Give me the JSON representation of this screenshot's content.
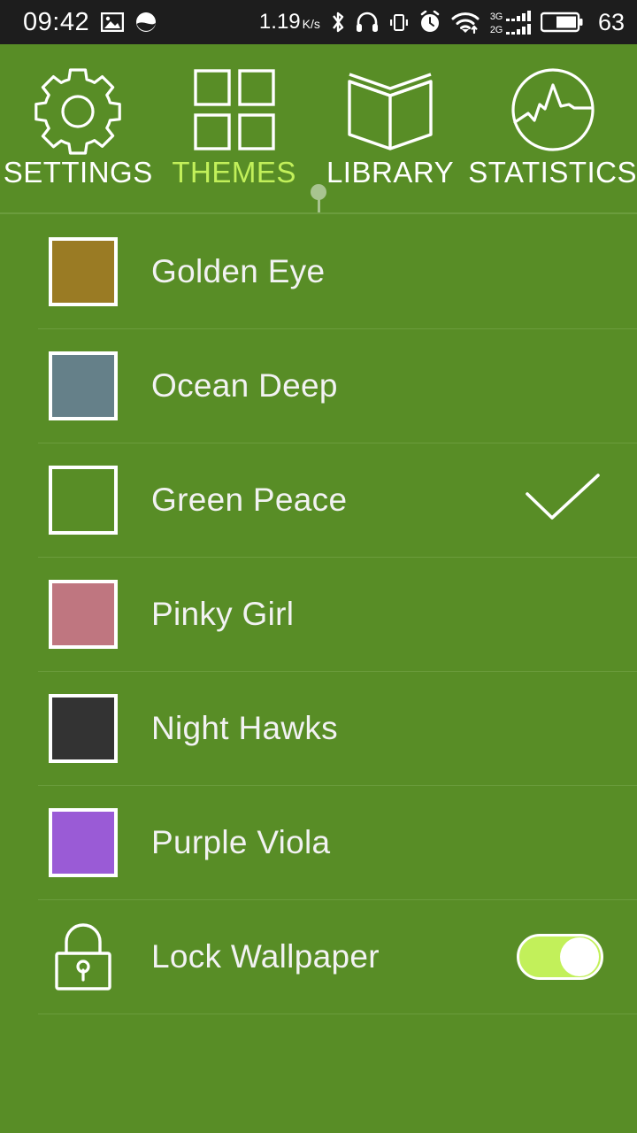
{
  "status_bar": {
    "time": "09:42",
    "network_speed": "1.19",
    "network_speed_unit": "K/s",
    "battery_percent": "63",
    "icons": [
      "image-icon",
      "brightness-icon",
      "bluetooth-icon",
      "headphones-icon",
      "vibrate-icon",
      "alarm-icon",
      "wifi-icon",
      "signal-icon",
      "battery-icon"
    ],
    "sim1_label": "3G",
    "sim2_label": "2G",
    "background": "#1d1d1d"
  },
  "tabs": [
    {
      "label": "SETTINGS",
      "icon": "gear-icon",
      "active": false
    },
    {
      "label": "THEMES",
      "icon": "grid-icon",
      "active": true
    },
    {
      "label": "LIBRARY",
      "icon": "book-icon",
      "active": false
    },
    {
      "label": "STATISTICS",
      "icon": "chart-circle-icon",
      "active": false
    }
  ],
  "theme": {
    "background": "#588d26",
    "accent": "#c2f05a",
    "divider": "#6b9c3d",
    "text": "#f2f2f2"
  },
  "themes_list": [
    {
      "name": "Golden Eye",
      "swatch": "#9a7b24",
      "selected": false
    },
    {
      "name": "Ocean Deep",
      "swatch": "#658089",
      "selected": false
    },
    {
      "name": "Green Peace",
      "swatch": "#588d26",
      "selected": true
    },
    {
      "name": "Pinky Girl",
      "swatch": "#bf7680",
      "selected": false
    },
    {
      "name": "Night Hawks",
      "swatch": "#333333",
      "selected": false
    },
    {
      "name": "Purple Viola",
      "swatch": "#9a5bd6",
      "selected": false
    }
  ],
  "lock_wallpaper": {
    "label": "Lock Wallpaper",
    "icon": "lock-icon",
    "enabled": true,
    "toggle_state": "on"
  }
}
